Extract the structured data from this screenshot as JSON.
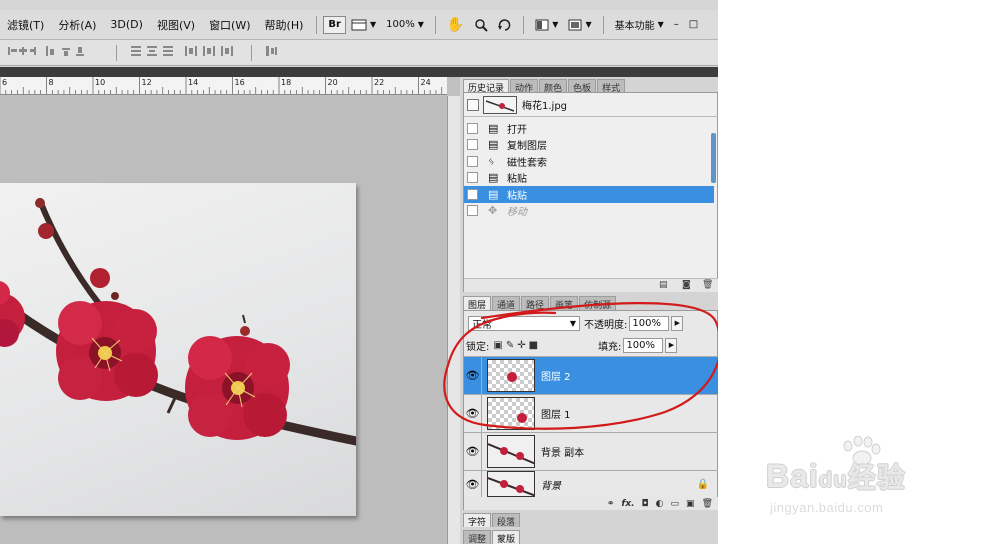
{
  "menu": {
    "items": [
      "滤镜(T)",
      "分析(A)",
      "3D(D)",
      "视图(V)",
      "窗口(W)",
      "帮助(H)"
    ],
    "br_label": "Br",
    "zoom": "100%",
    "workspace": "基本功能",
    "min_glyph": "–",
    "max_glyph": "□"
  },
  "ruler": {
    "ticks": [
      "6",
      "8",
      "10",
      "12",
      "14",
      "16",
      "18",
      "20",
      "22",
      "24"
    ]
  },
  "history": {
    "tabs": [
      "历史记录",
      "动作",
      "颜色",
      "色板",
      "样式"
    ],
    "snapshot_name": "梅花1.jpg",
    "items": [
      {
        "label": "打开",
        "state": "normal"
      },
      {
        "label": "复制图层",
        "state": "normal"
      },
      {
        "label": "磁性套索",
        "state": "normal"
      },
      {
        "label": "粘贴",
        "state": "normal"
      },
      {
        "label": "粘贴",
        "state": "selected"
      },
      {
        "label": "移动",
        "state": "dimmed"
      }
    ]
  },
  "layers": {
    "tabs": [
      "图层",
      "通道",
      "路径",
      "画笔",
      "仿制源"
    ],
    "blend_mode": "正常",
    "opacity_label": "不透明度:",
    "opacity_value": "100%",
    "lock_label": "锁定:",
    "fill_label": "填充:",
    "fill_value": "100%",
    "items": [
      {
        "name": "图层 2",
        "selected": true
      },
      {
        "name": "图层 1",
        "selected": false
      },
      {
        "name": "背景 副本",
        "selected": false
      },
      {
        "name": "背景",
        "selected": false
      }
    ],
    "footer_icons": [
      "link-icon",
      "fx-icon",
      "mask-icon",
      "adjustment-icon",
      "folder-icon",
      "new-layer-icon",
      "trash-icon"
    ],
    "fx_label": "fx."
  },
  "bottom_tabs_1": [
    "字符",
    "段落"
  ],
  "bottom_tabs_2": [
    "调整",
    "蒙版"
  ],
  "watermark": {
    "brand": "Bai",
    "brand_mid": "du",
    "brand_cn": "经验",
    "url": "jingyan.baidu.com"
  },
  "colors": {
    "selection_blue": "#3a8fe0",
    "annotation_red": "#d21a1a",
    "blossom": "#c41f3c"
  }
}
